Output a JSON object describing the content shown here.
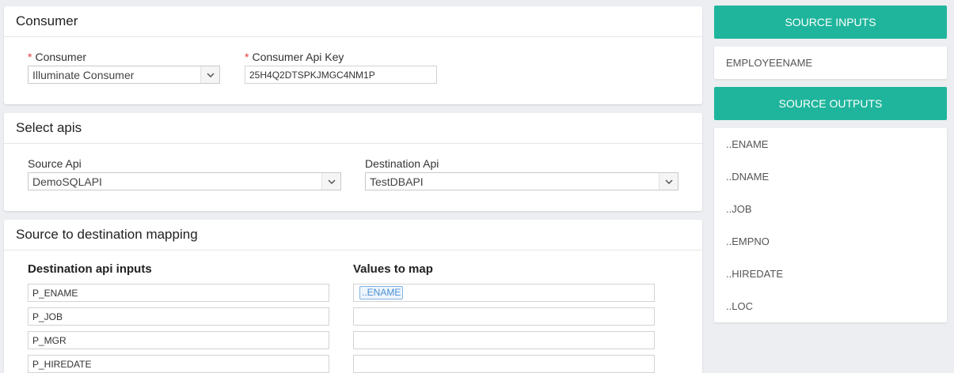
{
  "consumer_card": {
    "title": "Consumer",
    "consumer_label": "Consumer",
    "consumer_value": "Illuminate Consumer",
    "api_key_label": "Consumer Api Key",
    "api_key_value": "25H4Q2DTSPKJMGC4NM1P"
  },
  "apis_card": {
    "title": "Select apis",
    "source_label": "Source Api",
    "source_value": "DemoSQLAPI",
    "destination_label": "Destination Api",
    "destination_value": "TestDBAPI"
  },
  "mapping_card": {
    "title": "Source to destination mapping",
    "inputs_header": "Destination api inputs",
    "values_header": "Values to map",
    "rows": [
      {
        "input": "P_ENAME",
        "value": "..ENAME"
      },
      {
        "input": "P_JOB",
        "value": ""
      },
      {
        "input": "P_MGR",
        "value": ""
      },
      {
        "input": "P_HIREDATE",
        "value": ""
      }
    ]
  },
  "sidebar": {
    "inputs_title": "SOURCE INPUTS",
    "inputs": [
      "EMPLOYEENAME"
    ],
    "outputs_title": "SOURCE OUTPUTS",
    "outputs": [
      "..ENAME",
      "..DNAME",
      "..JOB",
      "..EMPNO",
      "..HIREDATE",
      "..LOC"
    ]
  },
  "colors": {
    "accent": "#1fb59c",
    "required": "#e4393c",
    "tag_border": "#7fb3e6"
  },
  "icons": {
    "dropdown": "chevron-down-icon"
  }
}
